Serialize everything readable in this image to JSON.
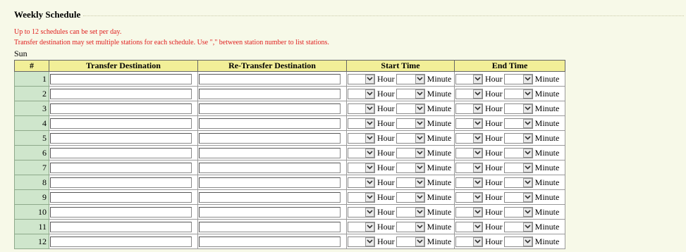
{
  "section": {
    "title": "Weekly Schedule"
  },
  "notes": {
    "line1": "Up to 12 schedules can be set per day.",
    "line2": "Transfer destination may set multiple stations for each schedule. Use \",\" between station number to list stations."
  },
  "day_label": "Sun",
  "table": {
    "headers": {
      "num": "#",
      "transfer": "Transfer Destination",
      "retransfer": "Re-Transfer Destination",
      "start": "Start Time",
      "end": "End Time"
    },
    "unit_hour": "Hour",
    "unit_minute": "Minute",
    "rows": [
      {
        "num": "1",
        "transfer": "",
        "retransfer": "",
        "start_hour": "",
        "start_minute": "",
        "end_hour": "",
        "end_minute": ""
      },
      {
        "num": "2",
        "transfer": "",
        "retransfer": "",
        "start_hour": "",
        "start_minute": "",
        "end_hour": "",
        "end_minute": ""
      },
      {
        "num": "3",
        "transfer": "",
        "retransfer": "",
        "start_hour": "",
        "start_minute": "",
        "end_hour": "",
        "end_minute": ""
      },
      {
        "num": "4",
        "transfer": "",
        "retransfer": "",
        "start_hour": "",
        "start_minute": "",
        "end_hour": "",
        "end_minute": ""
      },
      {
        "num": "5",
        "transfer": "",
        "retransfer": "",
        "start_hour": "",
        "start_minute": "",
        "end_hour": "",
        "end_minute": ""
      },
      {
        "num": "6",
        "transfer": "",
        "retransfer": "",
        "start_hour": "",
        "start_minute": "",
        "end_hour": "",
        "end_minute": ""
      },
      {
        "num": "7",
        "transfer": "",
        "retransfer": "",
        "start_hour": "",
        "start_minute": "",
        "end_hour": "",
        "end_minute": ""
      },
      {
        "num": "8",
        "transfer": "",
        "retransfer": "",
        "start_hour": "",
        "start_minute": "",
        "end_hour": "",
        "end_minute": ""
      },
      {
        "num": "9",
        "transfer": "",
        "retransfer": "",
        "start_hour": "",
        "start_minute": "",
        "end_hour": "",
        "end_minute": ""
      },
      {
        "num": "10",
        "transfer": "",
        "retransfer": "",
        "start_hour": "",
        "start_minute": "",
        "end_hour": "",
        "end_minute": ""
      },
      {
        "num": "11",
        "transfer": "",
        "retransfer": "",
        "start_hour": "",
        "start_minute": "",
        "end_hour": "",
        "end_minute": ""
      },
      {
        "num": "12",
        "transfer": "",
        "retransfer": "",
        "start_hour": "",
        "start_minute": "",
        "end_hour": "",
        "end_minute": ""
      }
    ]
  },
  "colors": {
    "page_background": "#f7f9e8",
    "header_background": "#f2ef98",
    "row_number_background": "#cfe6cc",
    "note_text": "#e02020"
  },
  "icons": {
    "dropdown": "chevron-down-icon"
  }
}
